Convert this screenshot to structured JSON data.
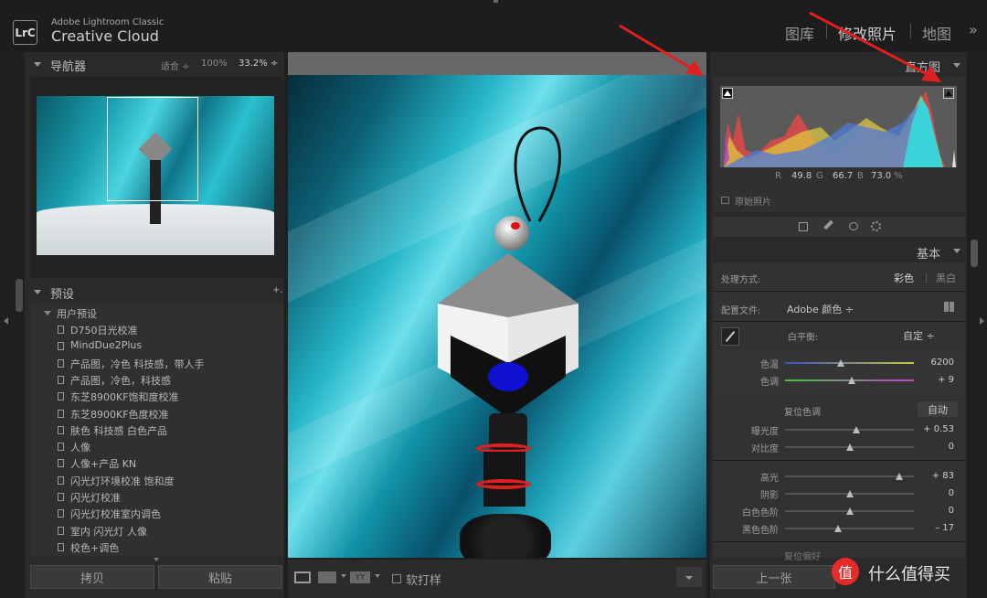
{
  "app": {
    "logo": "LrC",
    "brand_top": "Adobe Lightroom Classic",
    "brand_main": "Creative Cloud",
    "modules": [
      "图库",
      "修改照片",
      "地图"
    ],
    "more": "»"
  },
  "navigator": {
    "title": "导航器",
    "zoom_options": [
      "适合 ÷",
      "100%",
      "33.2% ÷"
    ]
  },
  "presets": {
    "title": "预设",
    "add": "+.",
    "group": "用户预设",
    "items": [
      "D750日光校准",
      "MindDue2Plus",
      "产品图，冷色 科技感，带人手",
      "产品图，冷色，科技感",
      "东芝8900KF饱和度校准",
      "东芝8900KF色度校准",
      "肤色 科技感 白色产品",
      "人像",
      "人像+产品 KN",
      "闪光灯环境校准 饱和度",
      "闪光灯校准",
      "闪光灯校准室内调色",
      "室内 闪光灯 人像",
      "校色+调色"
    ]
  },
  "left_buttons": {
    "copy": "拷贝",
    "paste": "粘贴"
  },
  "toolbar": {
    "yy": "YY",
    "softproof": "软打样"
  },
  "histogram": {
    "title": "直方图",
    "r_label": "R",
    "r_value": "49.8",
    "g_label": "G",
    "g_value": "66.7",
    "b_label": "B",
    "b_value": "73.0",
    "pct": "%",
    "original_photo": "原始照片"
  },
  "basic": {
    "title": "基本",
    "treatment_label": "处理方式:",
    "color": "彩色",
    "bw": "黑白",
    "profile_label": "配置文件:",
    "profile_value": "Adobe 颜色 ÷",
    "wb_label": "白平衡:",
    "wb_value": "自定 ÷",
    "temp_label": "色温",
    "temp_value": "6200",
    "tint_label": "色调",
    "tint_value": "+ 9",
    "tone_label": "复位色调",
    "auto": "自动",
    "exposure_label": "曝光度",
    "exposure_value": "+ 0.53",
    "contrast_label": "对比度",
    "contrast_value": "0",
    "highlights_label": "高光",
    "highlights_value": "+ 83",
    "shadows_label": "阴影",
    "shadows_value": "0",
    "whites_label": "白色色阶",
    "whites_value": "0",
    "blacks_label": "黑色色阶",
    "blacks_value": "– 17",
    "presence_label": "复位偏好"
  },
  "right_buttons": {
    "prev": "上一张"
  },
  "watermark": {
    "text": "什么值得买"
  },
  "slider_levels": {
    "temp": 0.43,
    "tint": 0.52,
    "exposure": 0.55,
    "contrast": 0.5,
    "highlights": 0.89,
    "shadows": 0.5,
    "whites": 0.5,
    "blacks": 0.41
  },
  "colors": {
    "accent": "#e02020",
    "histogram_bg": "#5a5a5a"
  }
}
